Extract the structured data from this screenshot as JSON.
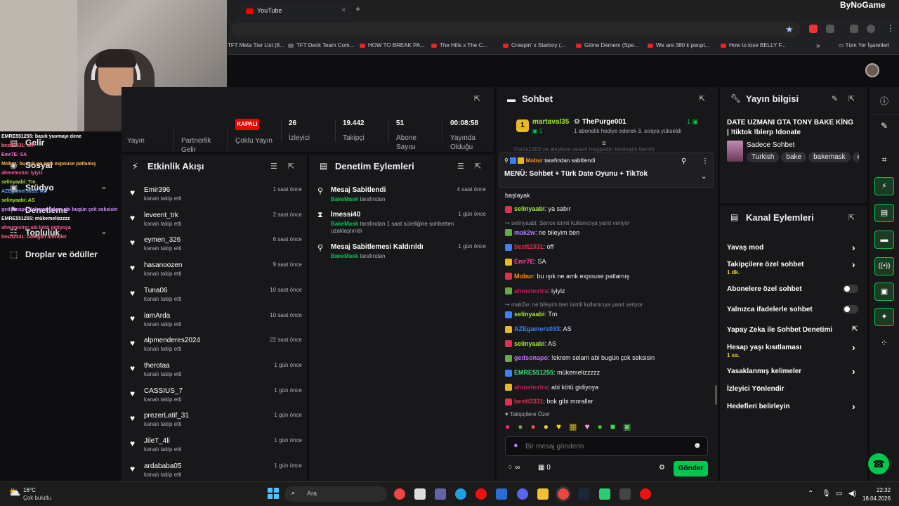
{
  "browser": {
    "tab_title": "YouTube",
    "tab_close": "×",
    "new_tab": "+",
    "bookmarks": [
      "TFT Meta Tier List (8...",
      "TFT Deck Team Com...",
      "HOW TO BREAK PA...",
      "The Hills x The C...",
      "Creepin' x Starboy (...",
      "Gitme Demem (Spe...",
      "We are 380 k peopl...",
      "How to lose BELLY F..."
    ],
    "bookmarks_more": "»",
    "all_bookmarks": "Tüm Yer İşaretleri",
    "brand_logo": "ByNoGame"
  },
  "left_nav": {
    "items": [
      {
        "label": "Gelir",
        "icon": "revenue-icon"
      },
      {
        "label": "Sosyal",
        "icon": "social-icon"
      },
      {
        "label": "Stüdyo",
        "icon": "studio-icon"
      },
      {
        "label": "Denetleme",
        "icon": "moderation-icon"
      },
      {
        "label": "Topluluk",
        "icon": "community-icon"
      },
      {
        "label": "Droplar ve ödüller",
        "icon": "drops-icon"
      }
    ]
  },
  "overlay_chat": [
    "EMRE551255: basılı yuvmayı dene",
    "bestt2331: off",
    "Emr7E: SA",
    "Mobur: bu ışık ne amk expouse patlamış",
    "ahmetextra: iyiyiz",
    "selinyaabi: Tm",
    "AZEgamers033: AS",
    "selinyaabi: AS",
    "gedsonapo: !ekrem selam abi bugün çok seksisin",
    "EMRE551255: mükemelizzzzz",
    "ahmetextra: abi kötü gidiyoya",
    "bestt2331: bok gibi moraller"
  ],
  "stats": {
    "items": [
      {
        "value": "",
        "label": "Yayın"
      },
      {
        "value": "",
        "label": "Partnerlik Gelir"
      },
      {
        "value": "KAPALI",
        "label": "Çoklu Yayın"
      },
      {
        "value": "26",
        "label": "İzleyici"
      },
      {
        "value": "19.442",
        "label": "Takipçi"
      },
      {
        "value": "51",
        "label": "Abone Sayısı"
      },
      {
        "value": "00:08:58",
        "label": "Yayında Olduğu"
      }
    ]
  },
  "activity": {
    "title": "Etkinlik Akışı",
    "rows": [
      {
        "name": "Emir396",
        "sub": "kanalı takip etti",
        "time": "1 saat önce"
      },
      {
        "name": "leveent_trk",
        "sub": "kanalı takip etti",
        "time": "2 saat önce"
      },
      {
        "name": "eymen_326",
        "sub": "kanalı takip etti",
        "time": "6 saat önce"
      },
      {
        "name": "hasanoozen",
        "sub": "kanalı takip etti",
        "time": "9 saat önce"
      },
      {
        "name": "Tuna06",
        "sub": "kanalı takip etti",
        "time": "10 saat önce"
      },
      {
        "name": "iamArda",
        "sub": "kanalı takip etti",
        "time": "10 saat önce"
      },
      {
        "name": "alpmenderes2024",
        "sub": "kanalı takip etti",
        "time": "22 saat önce"
      },
      {
        "name": "therotaa",
        "sub": "kanalı takip etti",
        "time": "1 gün önce"
      },
      {
        "name": "CASSIUS_7",
        "sub": "kanalı takip etti",
        "time": "1 gün önce"
      },
      {
        "name": "prezerLatif_31",
        "sub": "kanalı takip etti",
        "time": "1 gün önce"
      },
      {
        "name": "JileT_4li",
        "sub": "kanalı takip etti",
        "time": "1 gün önce"
      },
      {
        "name": "ardababa05",
        "sub": "kanalı takip etti",
        "time": "1 gün önce"
      }
    ]
  },
  "moderation": {
    "title": "Denetim Eylemleri",
    "rows": [
      {
        "title": "Mesaj Sabitlendi",
        "actor": "BakeMask",
        "sub": " tarafından",
        "time": "4 saat önce",
        "icon": "pin-icon"
      },
      {
        "title": "lmessi40",
        "actor": "BakeMask",
        "sub": " tarafından 1 saat süreliğine sohbetten uzaklaştırıldı",
        "time": "1 gün önce",
        "icon": "hourglass-icon"
      },
      {
        "title": "Mesaj Sabitlemesi Kaldırıldı",
        "actor": "BakeMask",
        "sub": " tarafından",
        "time": "1 gün önce",
        "icon": "unpin-icon"
      }
    ]
  },
  "chat": {
    "title": "Sohbet",
    "top_gifter": "martaval35",
    "top_gifter_count": "1",
    "gift_user": "ThePurge001",
    "gift_count": "1",
    "gift_text": "1 abonelik hediye ederek 3. sıraya yükseldi",
    "hidden_line": "Forza1303 ve aleykum selam hoşgeldin kardeşim benim",
    "pinned_by": "Mobur",
    "pinned_by_suffix": " tarafından sabitlendi",
    "pinned_text": "MENÜ: Sohbet + Türk Date Oyunu + TikTok",
    "start_line": "başlayak",
    "messages": [
      {
        "user": "selinyaabi",
        "color": "#a3e635",
        "text": "ya sabır",
        "reply": ""
      },
      {
        "user": "mak2w",
        "color": "#b07aff",
        "text": "ne bileyim ben",
        "reply": "selinyaabi: Sence isimli kullanıcıya yanıt veriyor"
      },
      {
        "user": "bestt2331",
        "color": "#e0304f",
        "text": "off",
        "reply": ""
      },
      {
        "user": "Emr7E",
        "color": "#ff3cac",
        "text": "SA",
        "reply": ""
      },
      {
        "user": "Mobur",
        "color": "#ff8c1a",
        "text": "bu ışık ne amk expouse patlamış",
        "reply": ""
      },
      {
        "user": "ahmetextra",
        "color": "#c2185b",
        "text": "iyiyiz",
        "reply": ""
      },
      {
        "user": "selinyaabi",
        "color": "#a3e635",
        "text": "Tm",
        "reply": "mak2w: ne bileyim ben isimli kullanıcıya yanıt veriyor"
      },
      {
        "user": "AZEgamers033",
        "color": "#3b82f6",
        "text": "AS",
        "reply": ""
      },
      {
        "user": "selinyaabi",
        "color": "#a3e635",
        "text": "AS",
        "reply": ""
      },
      {
        "user": "gedsonapo",
        "color": "#c86bff",
        "text": "!ekrem selam abi bugün çok seksisin",
        "reply": ""
      },
      {
        "user": "EMRE551255",
        "color": "#3ee07a",
        "text": "mükemelizzzzz",
        "reply": ""
      },
      {
        "user": "ahmetextra",
        "color": "#c2185b",
        "text": "abi kötü gidiyoya",
        "reply": ""
      },
      {
        "user": "bestt2331",
        "color": "#e0304f",
        "text": "bok gibi moraller",
        "reply": ""
      }
    ],
    "followers_only": "Takipçilere Özel",
    "input_placeholder": "Bir mesaj gönderin",
    "points": "0",
    "send_label": "Gönder"
  },
  "stream_info": {
    "title": "Yayın bilgisi",
    "stream_title": "DATE UZMANI GTA TONY BAKE KİNG | !tiktok !blerp !donate",
    "category": "Sadece Sohbet",
    "tags": [
      "Turkish",
      "bake",
      "bakemask",
      "en"
    ]
  },
  "channel_actions": {
    "title": "Kanal Eylemleri",
    "rows": [
      {
        "label": "Yavaş mod",
        "sub": "",
        "control": "arrow"
      },
      {
        "label": "Takipçilere özel sohbet",
        "sub": "1 dk.",
        "control": "arrow"
      },
      {
        "label": "Abonelere özel sohbet",
        "sub": "",
        "control": "toggle"
      },
      {
        "label": "Yalnızca ifadelerle sohbet",
        "sub": "",
        "control": "toggle"
      },
      {
        "label": "Yapay Zeka ile Sohbet Denetimi",
        "sub": "",
        "control": "external"
      },
      {
        "label": "Hesap yaşı kısıtlaması",
        "sub": "1 sa.",
        "control": "arrow"
      },
      {
        "label": "Yasaklanmış kelimeler",
        "sub": "",
        "control": "arrow"
      },
      {
        "label": "İzleyici Yönlendir",
        "sub": "",
        "control": "none"
      },
      {
        "label": "Hedefleri belirleyin",
        "sub": "",
        "control": "arrow"
      }
    ]
  },
  "taskbar": {
    "temperature": "16°C",
    "weather": "Çok bulutlu",
    "search_placeholder": "Ara",
    "time": "22:32",
    "date": "18.04.2026"
  },
  "colors": {
    "accent_green": "#00c74f",
    "live_red": "#eb0400",
    "panel_bg": "#18181b"
  }
}
